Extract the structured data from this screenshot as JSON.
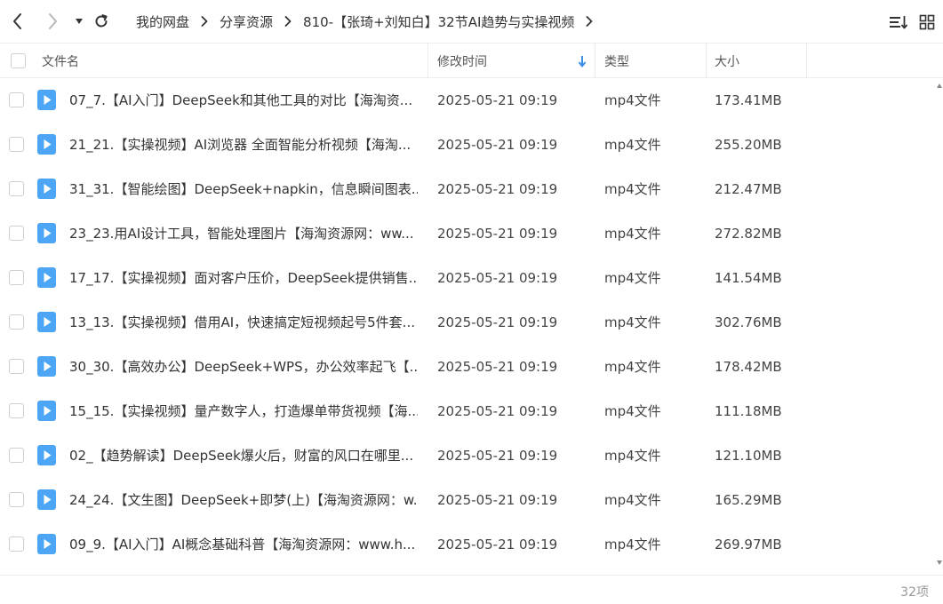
{
  "breadcrumb": {
    "items": [
      "我的网盘",
      "分享资源",
      "810-【张琦+刘知白】32节AI趋势与实操视频"
    ]
  },
  "table": {
    "headers": {
      "name": "文件名",
      "modified": "修改时间",
      "type": "类型",
      "size": "大小"
    },
    "sort": {
      "column": "modified",
      "direction": "desc"
    },
    "rows": [
      {
        "name": "07_7.【AI入门】DeepSeek和其他工具的对比【海淘资...",
        "modified": "2025-05-21 09:19",
        "type": "mp4文件",
        "size": "173.41MB"
      },
      {
        "name": "21_21.【实操视频】AI浏览器 全面智能分析视频【海淘...",
        "modified": "2025-05-21 09:19",
        "type": "mp4文件",
        "size": "255.20MB"
      },
      {
        "name": "31_31.【智能绘图】DeepSeek+napkin，信息瞬间图表...",
        "modified": "2025-05-21 09:19",
        "type": "mp4文件",
        "size": "212.47MB"
      },
      {
        "name": "23_23.用AI设计工具，智能处理图片【海淘资源网：ww...",
        "modified": "2025-05-21 09:19",
        "type": "mp4文件",
        "size": "272.82MB"
      },
      {
        "name": "17_17.【实操视频】面对客户压价，DeepSeek提供销售...",
        "modified": "2025-05-21 09:19",
        "type": "mp4文件",
        "size": "141.54MB"
      },
      {
        "name": "13_13.【实操视频】借用AI，快速搞定短视频起号5件套...",
        "modified": "2025-05-21 09:19",
        "type": "mp4文件",
        "size": "302.76MB"
      },
      {
        "name": "30_30.【高效办公】DeepSeek+WPS，办公效率起飞【...",
        "modified": "2025-05-21 09:19",
        "type": "mp4文件",
        "size": "178.42MB"
      },
      {
        "name": "15_15.【实操视频】量产数字人，打造爆单带货视频【海...",
        "modified": "2025-05-21 09:19",
        "type": "mp4文件",
        "size": "111.18MB"
      },
      {
        "name": "02_【趋势解读】DeepSeek爆火后，财富的风口在哪里...",
        "modified": "2025-05-21 09:19",
        "type": "mp4文件",
        "size": "121.10MB"
      },
      {
        "name": "24_24.【文生图】DeepSeek+即梦(上)【海淘资源网：w...",
        "modified": "2025-05-21 09:19",
        "type": "mp4文件",
        "size": "165.29MB"
      },
      {
        "name": "09_9.【AI入门】AI概念基础科普【海淘资源网：www.h...",
        "modified": "2025-05-21 09:19",
        "type": "mp4文件",
        "size": "269.97MB"
      }
    ]
  },
  "footer": {
    "count": "32项"
  },
  "colors": {
    "accent": "#3b8fe8",
    "file_icon": "#4da6f5",
    "border": "#ececec",
    "muted": "#999999"
  },
  "icons": {
    "back": "chevron-left-icon",
    "forward": "chevron-right-icon",
    "history": "caret-down-icon",
    "refresh": "refresh-icon",
    "sort": "sort-list-icon",
    "grid": "grid-view-icon",
    "file": "video-file-icon"
  }
}
